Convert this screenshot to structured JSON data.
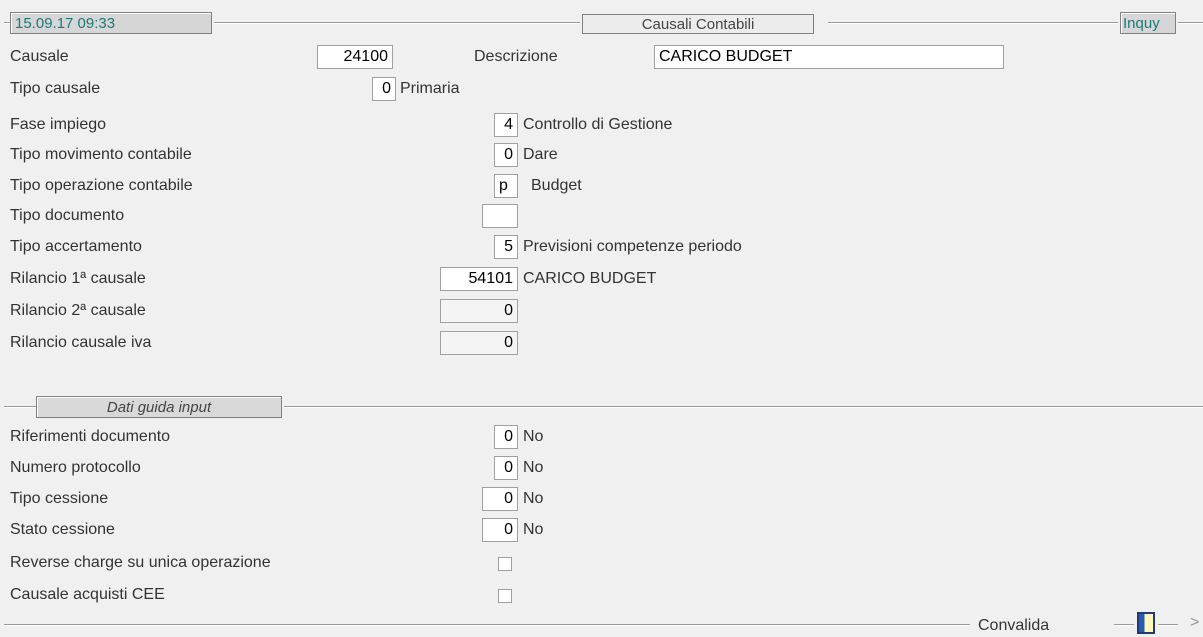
{
  "header": {
    "timestamp": "15.09.17 09:33",
    "title": "Causali Contabili",
    "mode": "Inquy"
  },
  "fields": {
    "causale_label": "Causale",
    "causale_value": "24100",
    "descrizione_label": "Descrizione",
    "descrizione_value": "CARICO BUDGET",
    "tipo_causale_label": "Tipo causale",
    "tipo_causale_value": "0",
    "tipo_causale_text": "Primaria",
    "fase_impiego_label": "Fase impiego",
    "fase_impiego_value": "4",
    "fase_impiego_text": "Controllo di Gestione",
    "tipo_movimento_label": "Tipo movimento contabile",
    "tipo_movimento_value": "0",
    "tipo_movimento_text": "Dare",
    "tipo_operazione_label": "Tipo operazione contabile",
    "tipo_operazione_value": "p",
    "tipo_operazione_text": "Budget",
    "tipo_documento_label": "Tipo documento",
    "tipo_documento_value": "",
    "tipo_accertamento_label": "Tipo accertamento",
    "tipo_accertamento_value": "5",
    "tipo_accertamento_text": "Previsioni competenze periodo",
    "rilancio1_label": "Rilancio 1ª causale",
    "rilancio1_value": "54101",
    "rilancio1_text": "CARICO BUDGET",
    "rilancio2_label": "Rilancio 2ª causale",
    "rilancio2_value": "0",
    "rilancio_iva_label": "Rilancio causale iva",
    "rilancio_iva_value": "0"
  },
  "section": {
    "title": "Dati guida input"
  },
  "input_guide": {
    "riferimenti_label": "Riferimenti documento",
    "riferimenti_value": "0",
    "riferimenti_text": "No",
    "protocollo_label": "Numero protocollo",
    "protocollo_value": "0",
    "protocollo_text": "No",
    "cessione_label": "Tipo cessione",
    "cessione_value": "0",
    "cessione_text": "No",
    "stato_label": "Stato cessione",
    "stato_value": "0",
    "stato_text": "No",
    "reverse_label": "Reverse charge su unica operazione",
    "cee_label": "Causale acquisti CEE"
  },
  "footer": {
    "convalida": "Convalida",
    "chevron": ">"
  }
}
